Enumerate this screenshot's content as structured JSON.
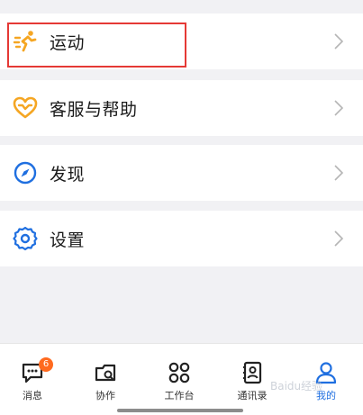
{
  "menu": {
    "items": [
      {
        "label": "运动",
        "icon": "running-icon"
      },
      {
        "label": "客服与帮助",
        "icon": "heart-support-icon"
      },
      {
        "label": "发现",
        "icon": "compass-icon"
      },
      {
        "label": "设置",
        "icon": "gear-icon"
      }
    ]
  },
  "tabbar": {
    "tabs": [
      {
        "label": "消息",
        "badge": "6"
      },
      {
        "label": "协作"
      },
      {
        "label": "工作台"
      },
      {
        "label": "通讯录"
      },
      {
        "label": "我的",
        "active": true
      }
    ]
  },
  "watermark": "Baidu经验",
  "colors": {
    "accent": "#1f6fe0",
    "sport_orange": "#f5a623",
    "badge": "#ff6a1f",
    "highlight": "#e53935"
  }
}
